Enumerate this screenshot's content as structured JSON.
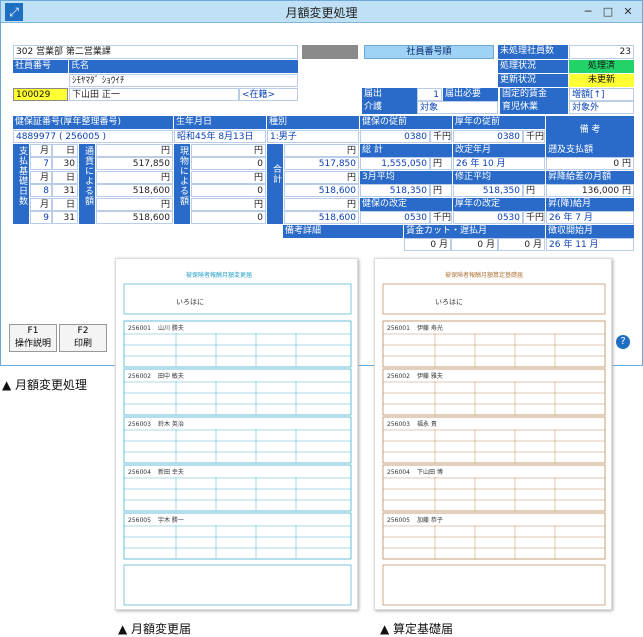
{
  "window": {
    "title": "月額変更処理",
    "minimize": "─",
    "maximize": "□",
    "close": "✕"
  },
  "header": {
    "dept": "302 営業部 第二営業課",
    "emp_no_label": "社員番号",
    "name_label": "氏名",
    "kana": "ｼﾓﾔﾏﾀﾞ ｼｮｳｲﾁ",
    "emp_no_value": "100029",
    "emp_name": "下山田 正一",
    "status_tag": "<在籍>",
    "sort_label": "社員番号順",
    "unprocessed_label": "未処理社員数",
    "unprocessed_value": "23",
    "process_status_label": "処理状況",
    "process_status_value": "処理済",
    "update_status_label": "更新状況",
    "update_status_value": "未更新",
    "report_label": "届出",
    "report_num": "1",
    "report_need": "届出必要",
    "fixed_wage_label": "固定的賃金",
    "fixed_wage_value": "増額[↑]",
    "care_label": "介護",
    "care_value": "対象",
    "childcare_label": "育児休業",
    "childcare_value": "対象外"
  },
  "info": {
    "insure_no_label": "健保証番号(厚年整理番号)",
    "insure_no_value": "4889977 ( 256005 )",
    "birth_label": "生年月日",
    "birth_value": "昭和45年 8月13日",
    "kind_label": "種別",
    "kind_value": "1:男子",
    "health_prev_label": "健保の従前",
    "health_prev_value": "0380",
    "pension_prev_label": "厚年の従前",
    "pension_prev_value": "0380",
    "unit": "千円",
    "remarks_label": "備 考"
  },
  "months": {
    "side_label": "支払基礎日数",
    "pay_label": "通貨による額",
    "goods_label": "現物による額",
    "total_label": "合計",
    "yen": "円",
    "rows": [
      {
        "month": "7",
        "days": "30",
        "pay": "517,850",
        "goods": "0",
        "total": "517,850"
      },
      {
        "month": "8",
        "days": "31",
        "pay": "518,600",
        "goods": "0",
        "total": "518,600"
      },
      {
        "month": "9",
        "days": "31",
        "pay": "518,600",
        "goods": "0",
        "total": "518,600"
      }
    ],
    "month_unit": "月",
    "day_unit": "日"
  },
  "calc": {
    "sum_label": "総 計",
    "sum_value": "1,555,050",
    "avg_label": "3月平均",
    "avg_value": "518,350",
    "health_rev_label": "健保の改定",
    "health_rev_value": "0530",
    "rev_month_label": "改定年月",
    "rev_year": "26",
    "rev_month": "10",
    "fixed_avg_label": "修正平均",
    "fixed_avg_value": "518,350",
    "pension_rev_label": "厚年の改定",
    "pension_rev_value": "0530",
    "retro_label": "遡及支払額",
    "retro_value": "0",
    "raise_label": "昇降給差の月額",
    "raise_value": "136,000",
    "raise_month_label": "昇(降)給月",
    "raise_year": "26",
    "raise_month": "7",
    "year_unit": "年",
    "detail_label": "備考詳細",
    "wage_cut_label": "賃金カット・遅払月",
    "cut1": "0",
    "cut2": "0",
    "cut3": "0",
    "retro_start_label": "徴収開始月",
    "retro_start_year": "26",
    "retro_start_month": "11"
  },
  "fkeys": [
    {
      "key": "F1",
      "label": "操作説明"
    },
    {
      "key": "F2",
      "label": "印刷"
    }
  ],
  "help": "?",
  "captions": {
    "main": "▲ 月額変更処理",
    "doc1": "▲ 月額変更届",
    "doc2": "▲ 算定基礎届"
  },
  "doc_form_text": "被保険者報酬月額変更届",
  "doc_form_text2": "被保険者報酬月額算定基礎届",
  "doc_stamp": "いろはに",
  "doc_rows": [
    {
      "code": "256001",
      "name": "山川 勝夫"
    },
    {
      "code": "256002",
      "name": "田中 敏夫"
    },
    {
      "code": "256003",
      "name": "鈴木 英治"
    },
    {
      "code": "256004",
      "name": "新田 幸夫"
    },
    {
      "code": "256005",
      "name": "宇木 勝一"
    }
  ],
  "doc_rows2": [
    {
      "code": "256001",
      "name": "伊藤 寿光"
    },
    {
      "code": "256002",
      "name": "伊藤 雅夫"
    },
    {
      "code": "256003",
      "name": "福永 貴"
    },
    {
      "code": "256004",
      "name": "下山田 博"
    },
    {
      "code": "256005",
      "name": "加藤 恭子"
    }
  ]
}
